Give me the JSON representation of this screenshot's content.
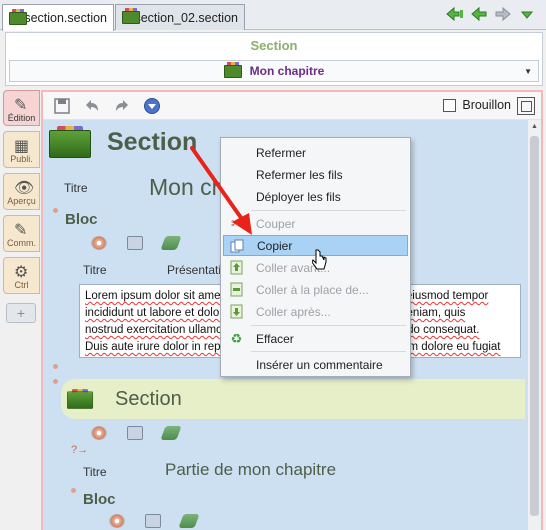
{
  "tabs": [
    {
      "label": "section.section",
      "active": true
    },
    {
      "label": "section_02.section",
      "active": false
    }
  ],
  "header": {
    "title": "Section",
    "chapter_select": "Mon chapitre"
  },
  "sidebar": {
    "items": [
      {
        "label": "Édition",
        "icon": "edit-icon",
        "active": true
      },
      {
        "label": "Publi.",
        "icon": "publish-icon"
      },
      {
        "label": "Aperçu",
        "icon": "preview-icon"
      },
      {
        "label": "Comm.",
        "icon": "comment-icon"
      },
      {
        "label": "Ctrl",
        "icon": "control-icon"
      }
    ]
  },
  "toolbar": {
    "draft_label": "Brouillon"
  },
  "editor": {
    "section_heading": "Section",
    "title_label": "Titre",
    "chapter_title": "Mon chapitre",
    "block_heading": "Bloc",
    "block_title_label": "Titre",
    "presentation_label": "Présentation",
    "body_lines": [
      "Lorem ipsum dolor sit amet, consectetur adipiscing elit, sed do eiusmod tempor",
      "incididunt ut labore et dolore magna aliqua. Ut enim ad minim veniam, quis",
      "nostrud exercitation ullamco laboris nisi ut aliquip ex ea commodo consequat.",
      "Duis aute irure dolor in reprehenderit in voluptate velit esse cillum dolore eu fugiat"
    ],
    "subsection_heading": "Section",
    "subsection_title_label": "Titre",
    "subsection_title": "Partie de mon chapitre",
    "subsection_block_heading": "Bloc"
  },
  "context_menu": {
    "items": [
      {
        "label": "Refermer",
        "disabled": false,
        "highlighted": false
      },
      {
        "label": "Refermer les fils",
        "disabled": false,
        "highlighted": false
      },
      {
        "label": "Déployer les fils",
        "disabled": false,
        "highlighted": false
      },
      {
        "label": "Couper",
        "disabled": true,
        "highlighted": false,
        "icon": "scissors-icon"
      },
      {
        "label": "Copier",
        "disabled": false,
        "highlighted": true,
        "icon": "copy-icon"
      },
      {
        "label": "Coller avant...",
        "disabled": true,
        "highlighted": false,
        "icon": "paste-before-icon"
      },
      {
        "label": "Coller à la place de...",
        "disabled": true,
        "highlighted": false,
        "icon": "paste-replace-icon"
      },
      {
        "label": "Coller après...",
        "disabled": true,
        "highlighted": false,
        "icon": "paste-after-icon"
      },
      {
        "label": "Effacer",
        "disabled": false,
        "highlighted": false,
        "icon": "refresh-icon"
      },
      {
        "label": "Insérer un commentaire",
        "disabled": false,
        "highlighted": false
      }
    ]
  },
  "colors": {
    "accent": "#8bb06a",
    "chapter": "#6a2e86",
    "editor_bg": "#cde0f2",
    "highlight": "#a9d2f5",
    "arrow": "#e8231a"
  }
}
